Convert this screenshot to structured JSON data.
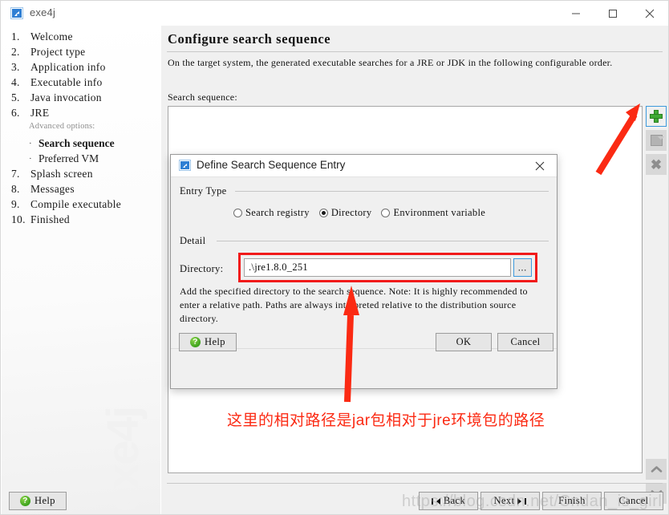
{
  "window": {
    "title": "exe4j",
    "icon": "exe4j-app-icon",
    "controls": {
      "minimize": "─",
      "maximize": "☐",
      "close": "✕"
    }
  },
  "sidebar": {
    "items": [
      {
        "num": "1.",
        "label": "Welcome"
      },
      {
        "num": "2.",
        "label": "Project type"
      },
      {
        "num": "3.",
        "label": "Application info"
      },
      {
        "num": "4.",
        "label": "Executable info"
      },
      {
        "num": "5.",
        "label": "Java invocation"
      },
      {
        "num": "6.",
        "label": "JRE"
      },
      {
        "num": "7.",
        "label": "Splash screen"
      },
      {
        "num": "8.",
        "label": "Messages"
      },
      {
        "num": "9.",
        "label": "Compile executable"
      },
      {
        "num": "10.",
        "label": "Finished"
      }
    ],
    "advanced_header": "Advanced options:",
    "advanced": [
      {
        "bullet": "·",
        "label": "Search sequence",
        "selected": true
      },
      {
        "bullet": "·",
        "label": "Preferred VM",
        "selected": false
      }
    ],
    "watermark": "exe4j"
  },
  "main": {
    "page_title": "Configure search sequence",
    "intro": "On the target system, the generated executable searches for a JRE or JDK in the following configurable order.",
    "sequence_label": "Search sequence:",
    "list_items": [],
    "tools": [
      {
        "name": "add-entry-button",
        "icon": "plus-icon",
        "enabled": true,
        "focused": true
      },
      {
        "name": "edit-entry-button",
        "icon": "edit-icon",
        "enabled": false,
        "focused": false
      },
      {
        "name": "remove-entry-button",
        "icon": "close-x-icon",
        "enabled": false,
        "focused": false
      }
    ],
    "reorder": [
      {
        "name": "move-up-button",
        "icon": "chevron-up-icon"
      },
      {
        "name": "move-down-button",
        "icon": "chevron-down-icon"
      }
    ]
  },
  "footer": {
    "help_label": "Help",
    "back_label": "Back",
    "next_label": "Next",
    "finish_label": "Finish",
    "cancel_label": "Cancel",
    "watermark": "https://blog.csdn.net/Cndan_is_girl"
  },
  "dialog": {
    "title": "Define Search Sequence Entry",
    "close_glyph": "✕",
    "entry_type": {
      "group_label": "Entry Type",
      "options": [
        {
          "label": "Search registry",
          "selected": false
        },
        {
          "label": "Directory",
          "selected": true
        },
        {
          "label": "Environment variable",
          "selected": false
        }
      ]
    },
    "detail": {
      "group_label": "Detail",
      "directory_label": "Directory:",
      "directory_value": ".\\jre1.8.0_251",
      "directory_placeholder": "",
      "browse_glyph": "⋯",
      "note": "Add the specified directory to the search sequence. Note: It is highly recommended to enter a relative path. Paths are always interpreted relative to the distribution source directory."
    },
    "buttons": {
      "help": "Help",
      "ok": "OK",
      "cancel": "Cancel"
    }
  },
  "annotations": {
    "chinese_note": "这里的相对路径是jar包相对于jre环境包的路径",
    "accent_color": "#fb2a13",
    "arrows": [
      {
        "name": "arrow-to-add-button",
        "direction": "up-right"
      },
      {
        "name": "arrow-to-directory-field",
        "direction": "up"
      }
    ],
    "highlight_color": "#f11a1a"
  },
  "help_glyph": "?"
}
